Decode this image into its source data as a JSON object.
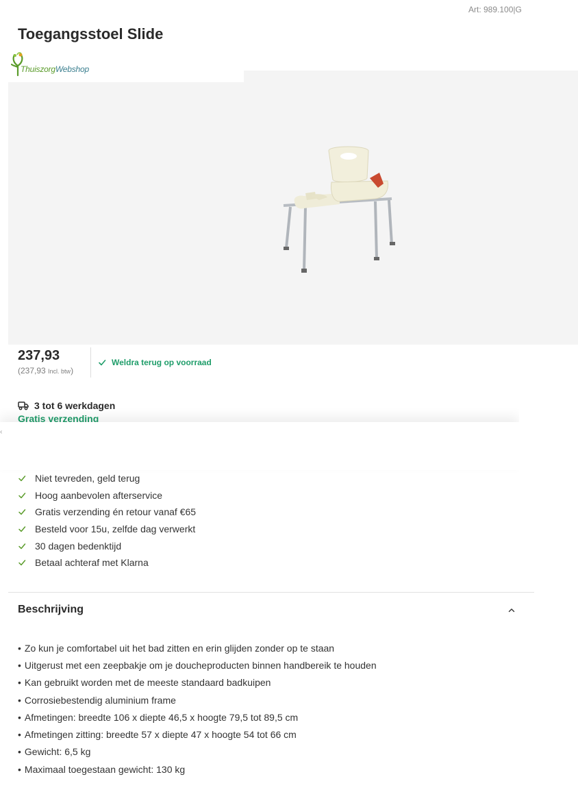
{
  "header": {
    "article_number": "Art: 989.100|G",
    "title": "Toegangsstoel Slide"
  },
  "brand": {
    "name_part1": "Thuiszorg",
    "name_part2": "Webshop",
    "color_primary": "#5a9b2a",
    "color_secondary": "#3b7f8f"
  },
  "pricing": {
    "price": "237,93",
    "price_incl_value": "(237,93",
    "price_incl_label": "Incl. btw",
    "price_incl_close": ")"
  },
  "stock": {
    "status": "Weldra terug op voorraad",
    "color": "#1f9d6a",
    "icon": "check-icon"
  },
  "delivery": {
    "icon": "truck-icon",
    "time": "3 tot 6 werkdagen",
    "shipping": "Gratis verzending"
  },
  "usps": [
    "Niet tevreden, geld terug",
    "Hoog aanbevolen afterservice",
    "Gratis verzending én retour vanaf €65",
    "Besteld voor 15u, zelfde dag verwerkt",
    "30 dagen bedenktijd",
    "Betaal achteraf met Klarna"
  ],
  "description": {
    "heading": "Beschrijving",
    "toggle_icon": "chevron-up-icon",
    "bullet": "•",
    "items": [
      "Zo kun je comfortabel uit het bad zitten en erin glijden zonder op te staan",
      "Uitgerust met een zeepbakje om je doucheproducten binnen handbereik te houden",
      "Kan gebruikt worden met de meeste standaard badkuipen",
      "Corrosiebestendig aluminium frame",
      "Afmetingen: breedte 106 x diepte 46,5 x hoogte 79,5 tot 89,5 cm",
      "Afmetingen zitting: breedte 57 x diepte 47 x hoogte 54 tot 66 cm",
      "Gewicht: 6,5 kg",
      "Maximaal toegestaan gewicht: 130 kg"
    ]
  }
}
